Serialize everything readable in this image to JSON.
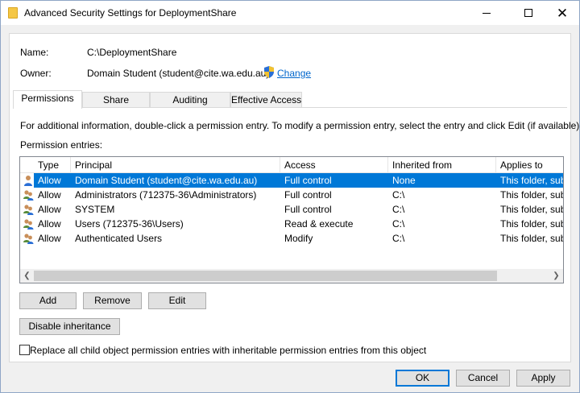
{
  "window": {
    "title": "Advanced Security Settings for DeploymentShare"
  },
  "details": {
    "name_label": "Name:",
    "name_value": "C:\\DeploymentShare",
    "owner_label": "Owner:",
    "owner_value": "Domain Student (student@cite.wa.edu.au)",
    "change_link": "Change"
  },
  "tabs": [
    {
      "label": "Permissions",
      "active": true
    },
    {
      "label": "Share",
      "active": false
    },
    {
      "label": "Auditing",
      "active": false
    },
    {
      "label": "Effective Access",
      "active": false
    }
  ],
  "permissions": {
    "info_text": "For additional information, double-click a permission entry. To modify a permission entry, select the entry and click Edit (if available).",
    "entries_label": "Permission entries:",
    "columns": [
      "Type",
      "Principal",
      "Access",
      "Inherited from",
      "Applies to"
    ],
    "rows": [
      {
        "icon": "user-icon",
        "type": "Allow",
        "principal": "Domain Student (student@cite.wa.edu.au)",
        "access": "Full control",
        "inherited": "None",
        "applies": "This folder, subfolders and files",
        "selected": true
      },
      {
        "icon": "group-icon",
        "type": "Allow",
        "principal": "Administrators (712375-36\\Administrators)",
        "access": "Full control",
        "inherited": "C:\\",
        "applies": "This folder, subfolders and files",
        "selected": false
      },
      {
        "icon": "group-icon",
        "type": "Allow",
        "principal": "SYSTEM",
        "access": "Full control",
        "inherited": "C:\\",
        "applies": "This folder, subfolders and files",
        "selected": false
      },
      {
        "icon": "group-icon",
        "type": "Allow",
        "principal": "Users (712375-36\\Users)",
        "access": "Read & execute",
        "inherited": "C:\\",
        "applies": "This folder, subfolders and files",
        "selected": false
      },
      {
        "icon": "group-icon",
        "type": "Allow",
        "principal": "Authenticated Users",
        "access": "Modify",
        "inherited": "C:\\",
        "applies": "This folder, subfolders and files",
        "selected": false
      }
    ],
    "buttons": {
      "add": "Add",
      "remove": "Remove",
      "edit": "Edit",
      "disable_inheritance": "Disable inheritance"
    },
    "replace_checkbox_label": "Replace all child object permission entries with inheritable permission entries from this object",
    "replace_checked": false
  },
  "footer": {
    "ok": "OK",
    "cancel": "Cancel",
    "apply": "Apply"
  },
  "colors": {
    "selection": "#0078d7",
    "link": "#0066cc"
  }
}
